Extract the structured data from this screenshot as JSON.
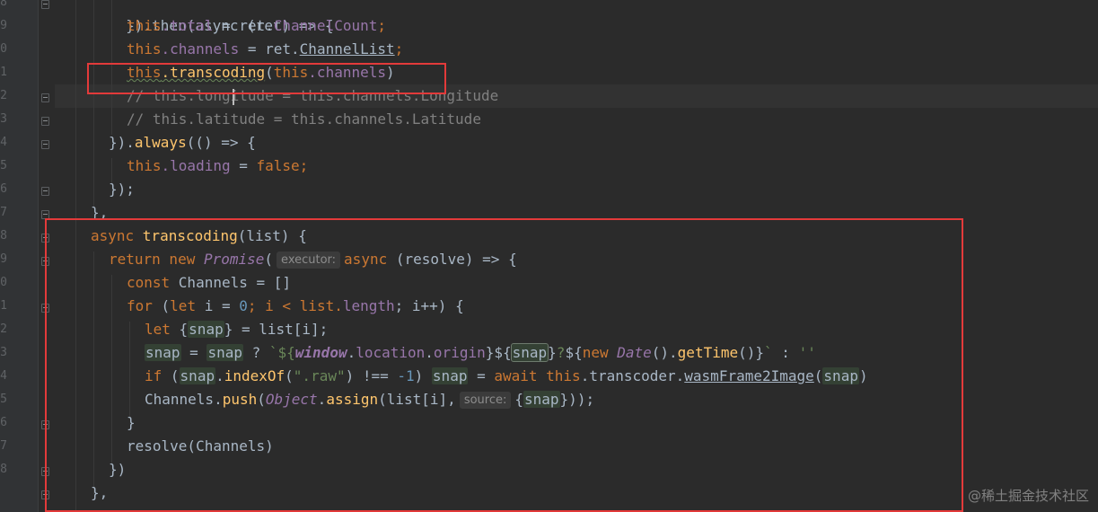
{
  "editor": {
    "line_numbers": [
      "8",
      "9",
      "0",
      "1",
      "2",
      "3",
      "4",
      "5",
      "6",
      "7",
      "8",
      "9",
      "0",
      "1",
      "2",
      "3",
      "4",
      "5",
      "6",
      "7",
      "8"
    ],
    "hints": {
      "executor": "executor:",
      "source": "source:"
    },
    "lines": {
      "l1": "}).then(async (ret) => {",
      "l2_this": "this",
      "l2_total": ".total",
      "l2_rest": " = ret.",
      "l2_val": "ChannelCount",
      "l2_end": ";",
      "l3_this": "this",
      "l3_prop": ".channels",
      "l3_rest": " = ret.",
      "l3_val": "ChannelList",
      "l3_end": ";",
      "l4_this": "this",
      "l4_fn": ".transcoding",
      "l4_open": "(",
      "l4_this2": "this",
      "l4_prop": ".channels",
      "l4_close": ")",
      "l5": "// this.longitude = this.channels.Longitude",
      "l6": "// this.latitude = this.channels.Latitude",
      "l7_a": "}).",
      "l7_fn": "always",
      "l7_b": "(() => {",
      "l8_this": "this",
      "l8_prop": ".loading",
      "l8_eq": " = ",
      "l8_val": "false",
      "l8_end": ";",
      "l9": "});",
      "l10": "},",
      "l11_kw": "async ",
      "l11_fn": "transcoding",
      "l11_rest": "(list) {",
      "l12_kw": "return new ",
      "l12_cls": "Promise",
      "l12_open": "(",
      "l12_kw2": "async ",
      "l12_rest": "(resolve) => {",
      "l13_kw": "const ",
      "l13_rest": "Channels = []",
      "l14_kw": "for ",
      "l14_a": "(",
      "l14_let": "let ",
      "l14_b": "i = ",
      "l14_num": "0",
      "l14_c": "; i < list.",
      "l14_len": "length",
      "l14_d": "; i++) {",
      "l15_kw": "let ",
      "l15_a": "{",
      "l15_snap": "snap",
      "l15_b": "} = list[i];",
      "l16_snap": "snap",
      "l16_a": " = ",
      "l16_snap2": "snap",
      "l16_b": " ? ",
      "l16_tick": "`${",
      "l16_win": "window",
      "l16_c": ".",
      "l16_loc": "location",
      "l16_d": ".",
      "l16_orig": "origin",
      "l16_e": "}${",
      "l16_snap3": "snap",
      "l16_f": "}",
      "l16_q": "?",
      "l16_g": "${",
      "l16_new": "new ",
      "l16_date": "Date",
      "l16_h": "().",
      "l16_gt": "getTime",
      "l16_i": "()}",
      "l16_tick2": "`",
      "l16_j": " : ",
      "l16_empty": "''",
      "l17_kw": "if ",
      "l17_a": "(",
      "l17_snap": "snap",
      "l17_b": ".",
      "l17_fn": "indexOf",
      "l17_c": "(",
      "l17_str": "\".raw\"",
      "l17_d": ") !== ",
      "l17_num": "-1",
      "l17_e": ") ",
      "l17_snap2": "snap",
      "l17_f": " = ",
      "l17_await": "await this",
      "l17_g": ".transcoder.",
      "l17_wasm": "wasmFrame2Image",
      "l17_h": "(",
      "l17_snap3": "snap",
      "l17_i": ")",
      "l18_a": "Channels.",
      "l18_push": "push",
      "l18_b": "(",
      "l18_obj": "Object",
      "l18_c": ".",
      "l18_assign": "assign",
      "l18_d": "(list[i],",
      "l18_e": "{",
      "l18_snap": "snap",
      "l18_f": "}));",
      "l19": "}",
      "l20": "resolve(Channels)",
      "l21": "})",
      "l22": "},"
    }
  },
  "watermark": "@稀土掘金技术社区",
  "colors": {
    "background": "#2b2b2b",
    "keyword": "#cc7832",
    "property": "#9876aa",
    "function": "#ffc66d",
    "number": "#6897bb",
    "string": "#6a8759",
    "comment": "#808080",
    "annotation_box": "#e33a3a"
  },
  "icons": {
    "fold_marker": "fold-marker-icon"
  }
}
